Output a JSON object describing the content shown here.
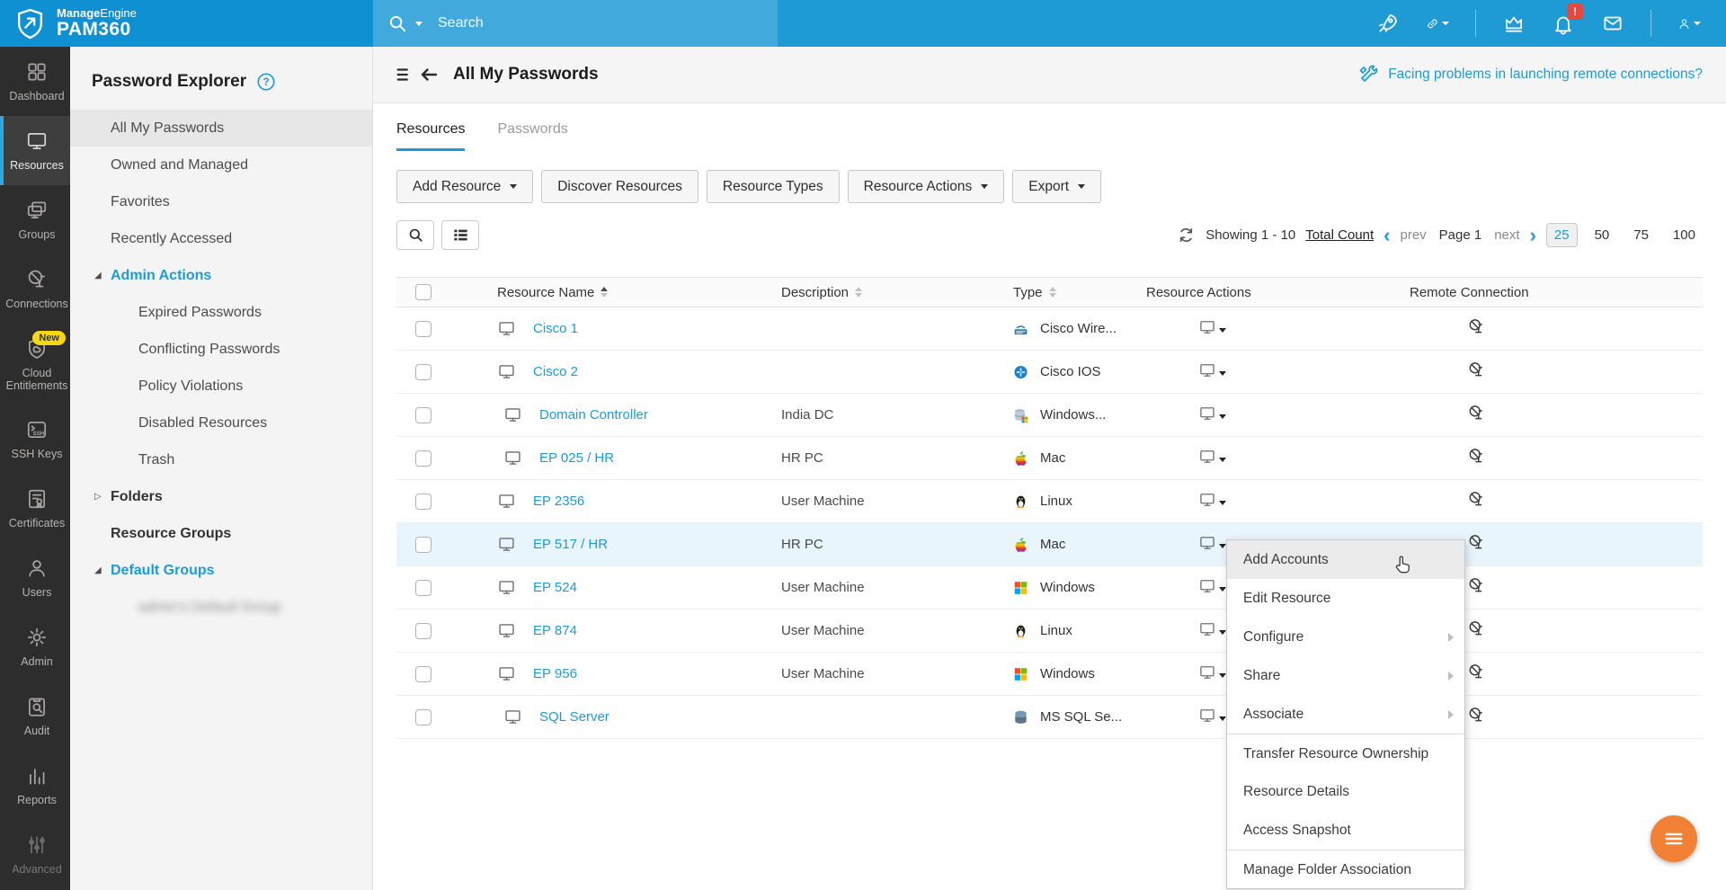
{
  "colors": {
    "header_blue": "#1e9ad5",
    "logo_blue": "#0f90d2",
    "search_blue": "#41a9dc",
    "accent": "#1b9cd8",
    "sidebar_bg": "#2d2d2d",
    "sidebar_active_accent": "#29abe2",
    "row_highlight": "#e9f5fc",
    "fab_orange": "#f28136",
    "badge_red": "#e8473e",
    "new_badge_yellow": "#f8d813"
  },
  "header": {
    "brand_bold": "Manage",
    "brand_light": "Engine",
    "product": "PAM360",
    "search_placeholder": "Search",
    "bell_badge": "!",
    "right_icons": [
      {
        "icon": "rocket-icon"
      },
      {
        "icon": "attachment-icon",
        "caret": true
      },
      {
        "divider": true
      },
      {
        "icon": "crown-icon"
      },
      {
        "icon": "bell-icon",
        "badge": "!"
      },
      {
        "icon": "mail-icon"
      },
      {
        "divider": true
      },
      {
        "icon": "user-menu-icon",
        "caret": true
      }
    ]
  },
  "sidebar": {
    "items": [
      {
        "label": "Dashboard",
        "icon": "dashboard-icon"
      },
      {
        "label": "Resources",
        "icon": "resources-icon",
        "active": true
      },
      {
        "label": "Groups",
        "icon": "groups-icon"
      },
      {
        "label": "Connections",
        "icon": "connections-icon"
      },
      {
        "label": "Cloud Entitlements",
        "icon": "cloud-entitlements-icon",
        "badge": "New"
      },
      {
        "label": "SSH Keys",
        "icon": "ssh-keys-icon"
      },
      {
        "label": "Certificates",
        "icon": "certificates-icon"
      },
      {
        "label": "Users",
        "icon": "users-icon"
      },
      {
        "label": "Admin",
        "icon": "admin-icon"
      },
      {
        "label": "Audit",
        "icon": "audit-icon"
      },
      {
        "label": "Reports",
        "icon": "reports-icon"
      },
      {
        "label": "Advanced",
        "icon": "advanced-icon",
        "clipped": true
      }
    ]
  },
  "explorer": {
    "title": "Password Explorer",
    "items": [
      {
        "label": "All My Passwords",
        "selected": true
      },
      {
        "label": "Owned and Managed"
      },
      {
        "label": "Favorites"
      },
      {
        "label": "Recently Accessed"
      },
      {
        "label": "Admin Actions",
        "style": "expanded-blue"
      },
      {
        "label": "Expired Passwords",
        "indent": true
      },
      {
        "label": "Conflicting Passwords",
        "indent": true
      },
      {
        "label": "Policy Violations",
        "indent": true
      },
      {
        "label": "Disabled Resources",
        "indent": true
      },
      {
        "label": "Trash",
        "indent": true
      },
      {
        "label": "Folders",
        "style": "collapsed-bold"
      },
      {
        "label": "Resource Groups",
        "style": "bold"
      },
      {
        "label": "Default Groups",
        "style": "expanded-blue"
      },
      {
        "label": "admin's Default Group",
        "indent": true,
        "redacted": true
      }
    ]
  },
  "main": {
    "title": "All My Passwords",
    "banner_link": "Facing problems in launching remote connections?",
    "tabs": [
      {
        "label": "Resources",
        "active": true
      },
      {
        "label": "Passwords"
      }
    ],
    "toolbar": [
      {
        "label": "Add Resource",
        "dropdown": true
      },
      {
        "label": "Discover Resources"
      },
      {
        "label": "Resource Types"
      },
      {
        "label": "Resource Actions",
        "dropdown": true
      },
      {
        "label": "Export",
        "dropdown": true
      }
    ],
    "pagination": {
      "showing": "Showing 1 - 10",
      "total_link": "Total Count",
      "prev_label": "prev",
      "page_label": "Page 1",
      "next_label": "next",
      "page_sizes": [
        "25",
        "50",
        "75",
        "100"
      ],
      "active_size": "25"
    }
  },
  "table": {
    "columns": [
      {
        "label": "Resource Name",
        "sort": "asc"
      },
      {
        "label": "Description",
        "sort": "none"
      },
      {
        "label": "Type",
        "sort": "none"
      },
      {
        "label": "Resource Actions"
      },
      {
        "label": "Remote Connection"
      }
    ],
    "rows": [
      {
        "name": "Cisco 1",
        "description": "",
        "type": "Cisco Wire...",
        "type_icon": "cisco-wireless-icon"
      },
      {
        "name": "Cisco 2",
        "description": "",
        "type": "Cisco IOS",
        "type_icon": "cisco-ios-icon"
      },
      {
        "name": "Domain Controller",
        "description": "India DC",
        "type": "Windows...",
        "type_icon": "windows-server-icon",
        "indent": true
      },
      {
        "name": "EP 025 / HR",
        "description": "HR PC",
        "type": "Mac",
        "type_icon": "mac-icon",
        "indent": true
      },
      {
        "name": "EP 2356",
        "description": "User Machine",
        "type": "Linux",
        "type_icon": "linux-icon"
      },
      {
        "name": "EP 517 / HR",
        "description": "HR PC",
        "type": "Mac",
        "type_icon": "mac-icon",
        "highlight": true
      },
      {
        "name": "EP 524",
        "description": "User Machine",
        "type": "Windows",
        "type_icon": "windows-icon"
      },
      {
        "name": "EP 874",
        "description": "User Machine",
        "type": "Linux",
        "type_icon": "linux-icon"
      },
      {
        "name": "EP 956",
        "description": "User Machine",
        "type": "Windows",
        "type_icon": "windows-icon"
      },
      {
        "name": "SQL Server",
        "description": "",
        "type": "MS SQL Se...",
        "type_icon": "mssql-icon",
        "indent": true
      }
    ]
  },
  "context_menu": {
    "items": [
      {
        "label": "Add Accounts",
        "hovered": true
      },
      {
        "label": "Edit Resource"
      },
      {
        "label": "Configure",
        "submenu": true
      },
      {
        "label": "Share",
        "submenu": true
      },
      {
        "label": "Associate",
        "submenu": true
      },
      {
        "label": "Transfer Resource Ownership",
        "divider_above": true
      },
      {
        "label": "Resource Details"
      },
      {
        "label": "Access Snapshot"
      },
      {
        "label": "Manage Folder Association",
        "divider_above": true
      }
    ]
  }
}
